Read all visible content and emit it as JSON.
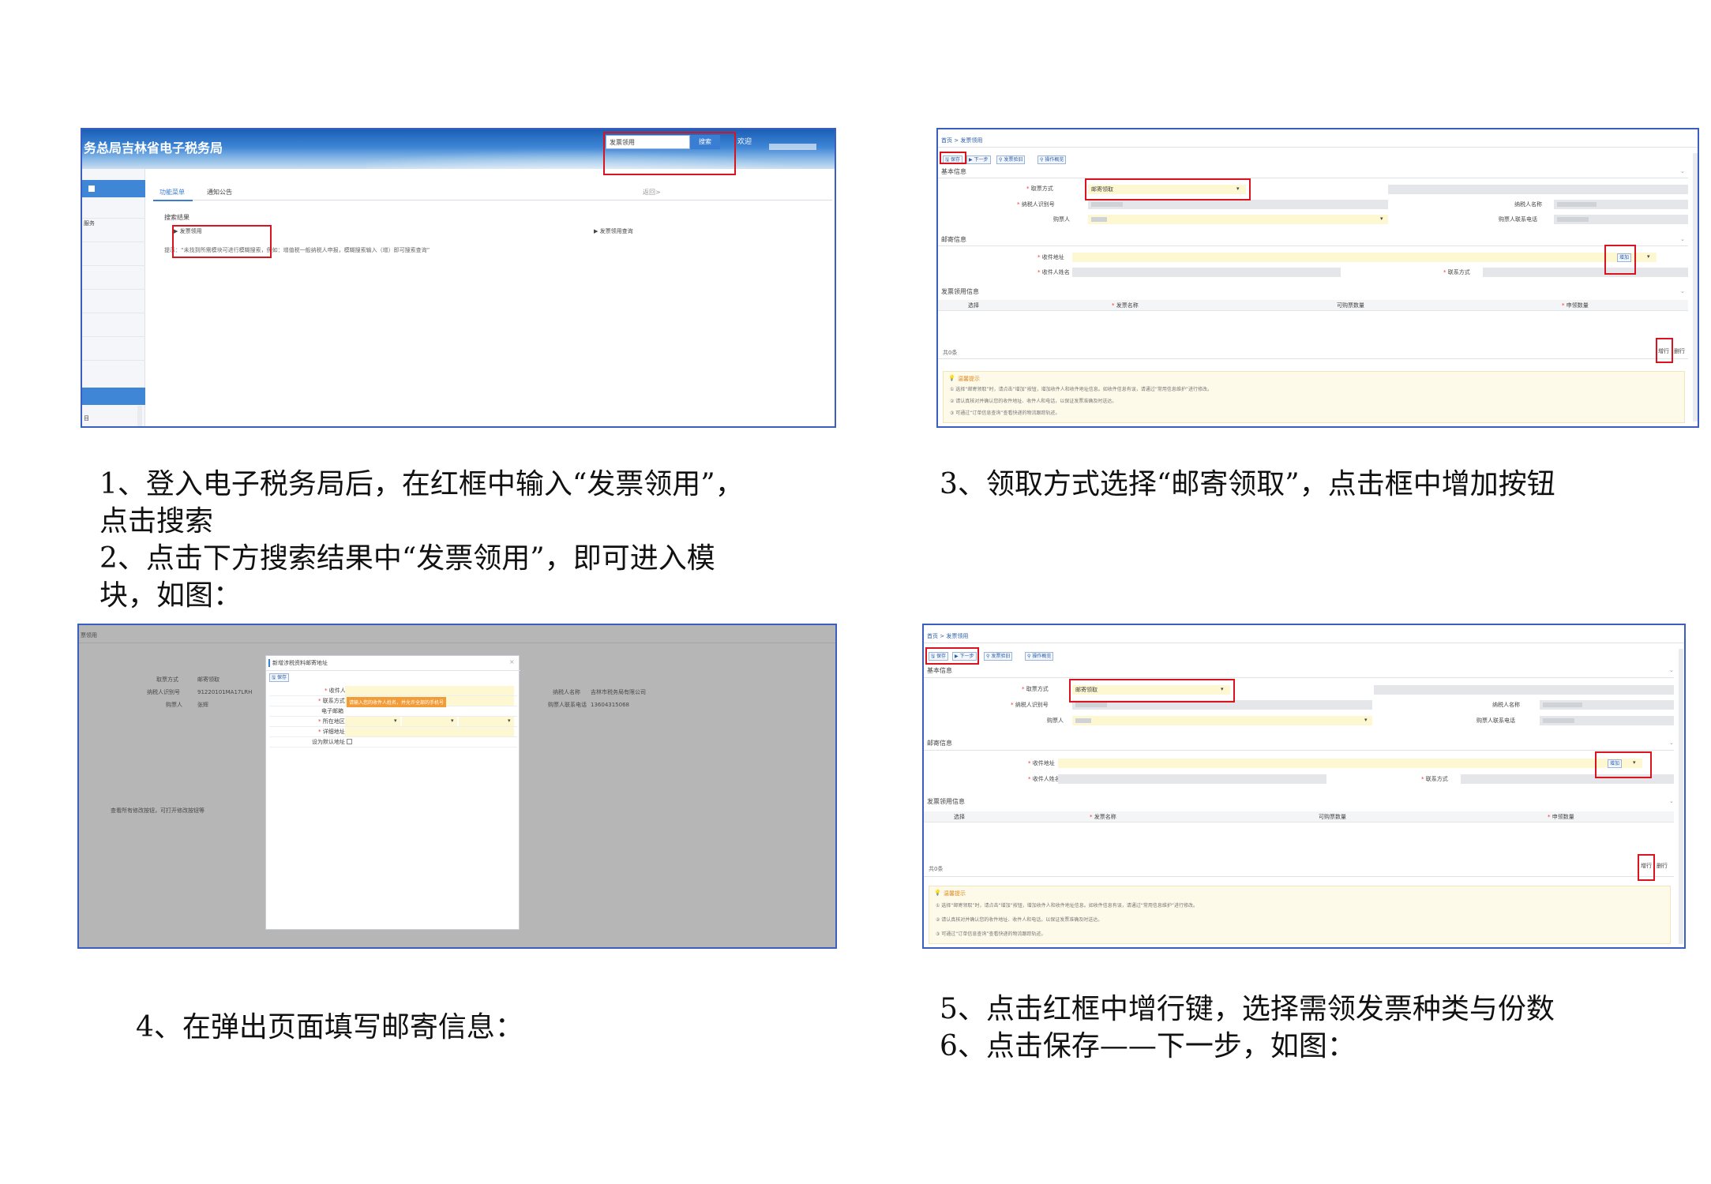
{
  "panel1": {
    "banner_title": "务总局吉林省电子税务局",
    "search_value": "发票领用",
    "search_button": "搜索",
    "welcome": "欢迎",
    "tab_menu": "功能菜单",
    "tab_notice": "通知公告",
    "return_link": "返回>",
    "results_heading": "搜索结果",
    "result_invoice_use": "发票领用",
    "result_invoice_query": "发票领用查询",
    "tip_text": "提示：“未找到所需模块可进行模糊搜索，例如：增值税一般纳税人申报，模糊搜索输入（增）即可搜索查询”",
    "side_label_1": "服务",
    "side_label_2": "目"
  },
  "panel2": {
    "breadcrumb": "首页 > 发票领用",
    "toolbar": [
      "保存",
      "下一步",
      "发票验旧",
      "操作概览"
    ],
    "section_basic": "基本信息",
    "label_method": "取票方式",
    "method_value": "邮寄领取",
    "label_taxid": "纳税人识别号",
    "label_taxname": "纳税人名称",
    "label_buyer": "购票人",
    "label_buyer_phone": "购票人联系电话",
    "section_mail": "邮寄信息",
    "label_address": "收件地址",
    "add_button": "增加",
    "label_recipient": "收件人姓名",
    "label_contact": "联系方式",
    "section_apply": "发票领用信息",
    "col_select": "选择",
    "col_name": "发票名称",
    "col_available": "可购票数量",
    "col_apply": "申领数量",
    "total": "共0条",
    "add_row": "增行",
    "del_row": "删行",
    "tips_title": "温馨提示",
    "tips": [
      "① 选择“邮寄领取”时，请点击“增加”按钮，增加收件人和收件地址信息。如收件信息有误，请通过“常用信息维护”进行修改。",
      "② 请认真核对并确认您的收件地址、收件人和电话，以保证发票准确及时送达。",
      "③ 可通过“订单信息查询”查看快递的物流跟踪轨迹。"
    ]
  },
  "panel3": {
    "breadcrumb": "票领用",
    "modal_title": "新增涉税资料邮寄地址",
    "save": "保存",
    "label_recipient": "收件人",
    "label_contact": "联系方式",
    "contact_hint": "请输入您的收件人姓名，并允许全部的手机号",
    "label_email": "电子邮箱",
    "label_region": "所在地区",
    "label_detail": "详细地址",
    "label_default": "设为默认地址",
    "bg_method": "取票方式",
    "bg_method_value": "邮寄领取",
    "bg_taxid": "纳税人识别号",
    "bg_taxid_value": "91220101MA17LRH",
    "bg_buyer": "购票人",
    "bg_buyer_value": "张辉",
    "bg_taxname": "纳税人名称",
    "bg_taxname_value": "吉林市税务局有限公司",
    "bg_buyer_phone": "购票人联系电话",
    "bg_phone_value": "13604315068",
    "bg_note": "查看所有修改按钮，可打开修改按钮等"
  },
  "captions": {
    "c1_line1": "1、登入电子税务局后，在红框中输入“发票领用”，",
    "c1_line2": "点击搜索",
    "c1_line3": "2、点击下方搜索结果中“发票领用”，即可进入模",
    "c1_line4": "块，如图：",
    "c3": "3、领取方式选择“邮寄领取”，点击框中增加按钮",
    "c4": "4、在弹出页面填写邮寄信息：",
    "c5": "5、点击红框中增行键，选择需领发票种类与份数",
    "c6": "6、点击保存——下一步，如图："
  },
  "colors": {
    "frame": "#3b5fc0",
    "highlight": "#d9141e",
    "banner": "#3f86d6",
    "required_field": "#fdf7d2"
  }
}
